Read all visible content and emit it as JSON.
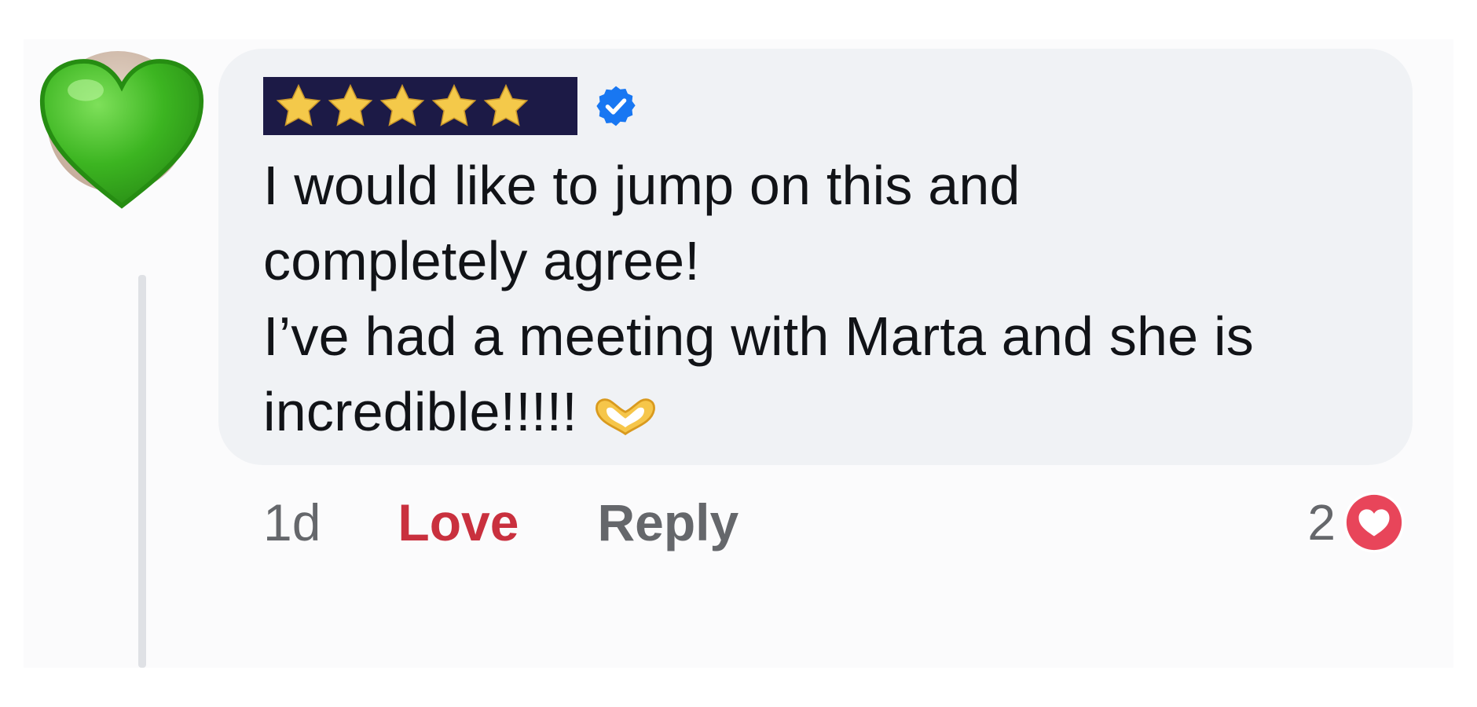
{
  "comment": {
    "author_rating_stars": 5,
    "text_lines": [
      "I would like to jump on this and",
      "completely agree!",
      "I’ve had a meeting with Marta and she is",
      "incredible!!!!!"
    ],
    "emoji": "heart-hands-icon"
  },
  "actions": {
    "time": "1d",
    "love_label": "Love",
    "reply_label": "Reply"
  },
  "reactions": {
    "count": "2",
    "icon": "love-reaction-icon"
  },
  "colors": {
    "love": "#c9303e",
    "verified": "#1877f2",
    "bubble": "#f0f2f5",
    "overlay_heart": "#3cb521"
  }
}
